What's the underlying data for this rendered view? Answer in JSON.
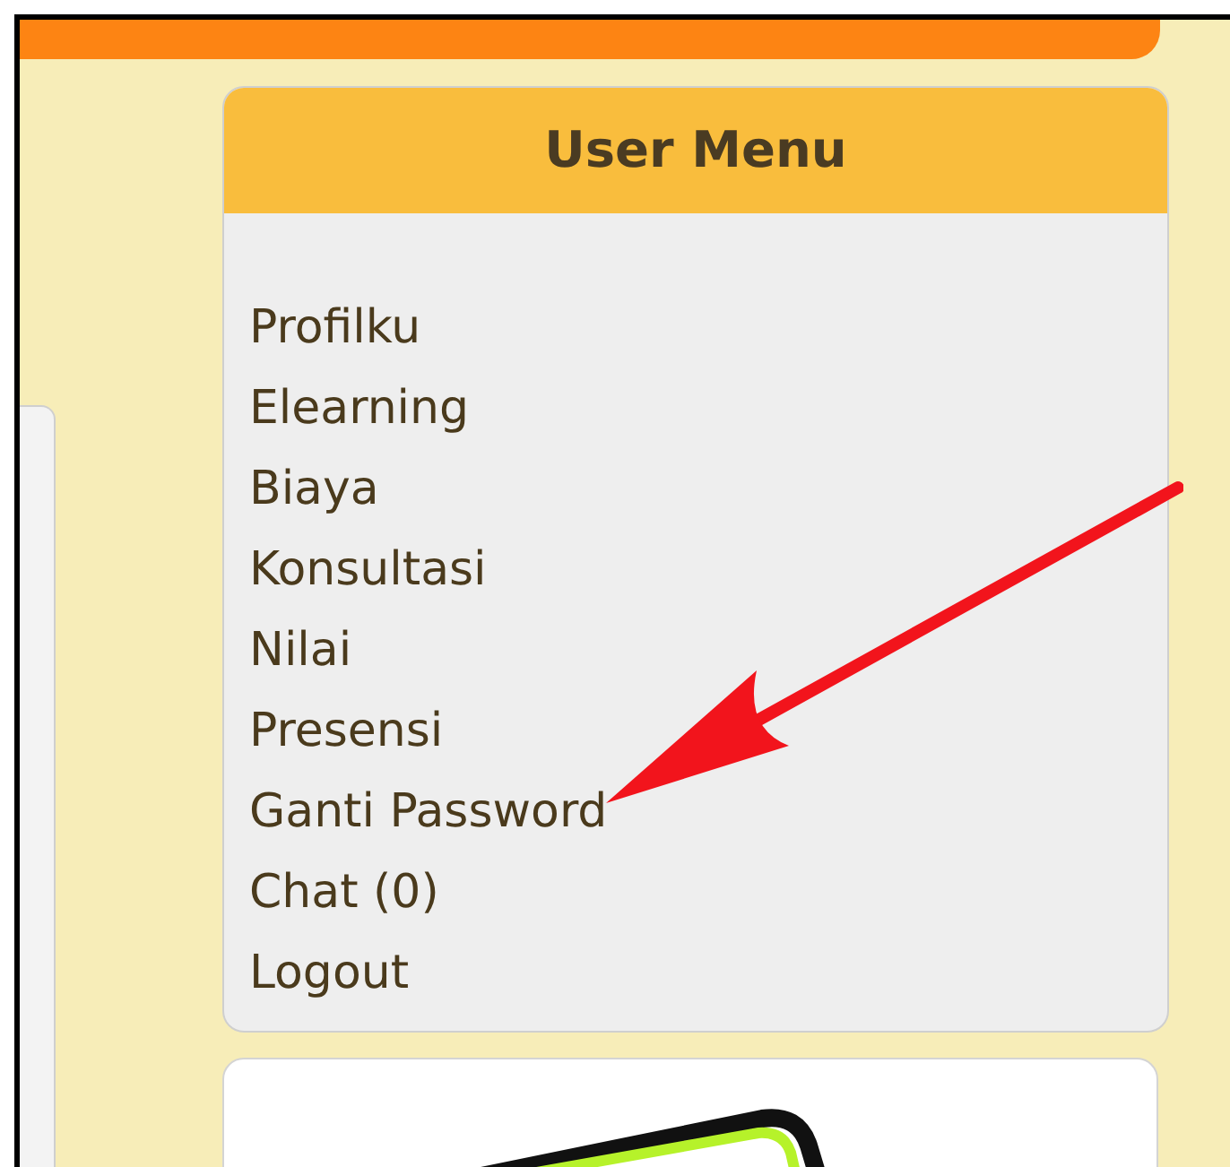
{
  "user_menu": {
    "title": "User Menu",
    "items": [
      {
        "label": "Profilku"
      },
      {
        "label": "Elearning"
      },
      {
        "label": "Biaya"
      },
      {
        "label": "Konsultasi"
      },
      {
        "label": "Nilai"
      },
      {
        "label": "Presensi"
      },
      {
        "label": "Ganti Password"
      },
      {
        "label": "Chat (0)"
      },
      {
        "label": "Logout"
      }
    ]
  }
}
